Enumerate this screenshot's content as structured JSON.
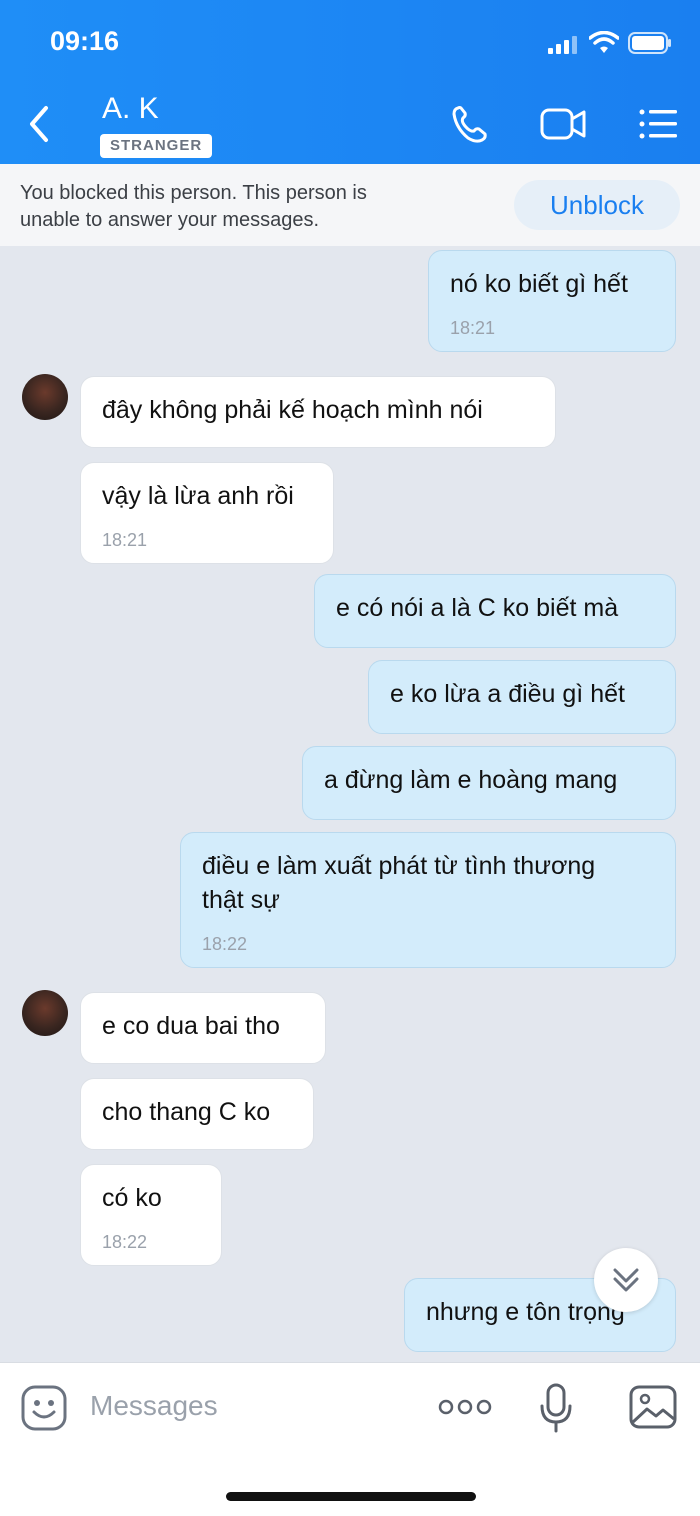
{
  "status_bar": {
    "time": "09:16"
  },
  "header": {
    "contact_name": "A. K",
    "badge": "STRANGER",
    "icons": [
      "back-icon",
      "phone-icon",
      "video-call-icon",
      "menu-icon"
    ]
  },
  "banner": {
    "line1": "You blocked this person. This person is",
    "line2": "unable to answer your messages.",
    "button": "Unblock"
  },
  "messages": [
    {
      "dir": "out",
      "text": "nó ko biết gì hết",
      "time": "18:21"
    },
    {
      "dir": "in",
      "text": "đây không phải kế hoạch mình nói"
    },
    {
      "dir": "in",
      "text": "vậy là lừa anh rồi",
      "time": "18:21"
    },
    {
      "dir": "out",
      "text": "e có nói a là C ko biết mà"
    },
    {
      "dir": "out",
      "text": "e ko lừa a điều gì hết"
    },
    {
      "dir": "out",
      "text": "a đừng làm e hoàng mang"
    },
    {
      "dir": "out",
      "text_line1": "điều e làm xuất phát từ tình thương",
      "text_line2": "thật sự",
      "time": "18:22"
    },
    {
      "dir": "in",
      "text": "e co dua bai tho"
    },
    {
      "dir": "in",
      "text": "cho thang C ko"
    },
    {
      "dir": "in",
      "text": "có ko",
      "time": "18:22"
    },
    {
      "dir": "out",
      "text": "nhưng e tôn trọng"
    }
  ],
  "composer": {
    "placeholder": "Messages"
  },
  "colors": {
    "accent": "#1a7ff0",
    "outgoing": "#d3ecfb",
    "incoming": "#ffffff",
    "background": "#e3e7ee"
  }
}
